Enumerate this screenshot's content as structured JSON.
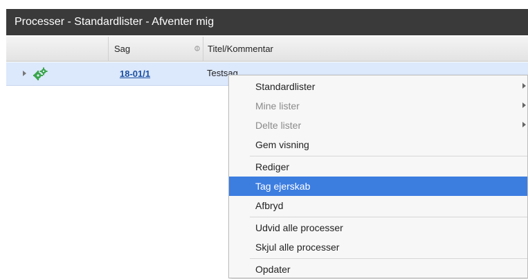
{
  "window": {
    "title": "Processer - Standardlister - Afventer mig"
  },
  "table": {
    "columns": {
      "sag": "Sag",
      "title": "Titel/Kommentar"
    },
    "rows": [
      {
        "case_number": "18-01/1",
        "title": "Testsag"
      }
    ]
  },
  "context_menu": {
    "items": [
      {
        "label": "Standardlister",
        "state": "enabled",
        "submenu": true
      },
      {
        "label": "Mine lister",
        "state": "disabled",
        "submenu": true
      },
      {
        "label": "Delte lister",
        "state": "disabled",
        "submenu": true
      },
      {
        "label": "Gem visning",
        "state": "enabled",
        "submenu": false
      },
      {
        "label": "Rediger",
        "state": "enabled",
        "submenu": false
      },
      {
        "label": "Tag ejerskab",
        "state": "highlighted",
        "submenu": false
      },
      {
        "label": "Afbryd",
        "state": "enabled",
        "submenu": false
      },
      {
        "label": "Udvid alle processer",
        "state": "enabled",
        "submenu": false
      },
      {
        "label": "Skjul alle processer",
        "state": "enabled",
        "submenu": false
      },
      {
        "label": "Opdater",
        "state": "enabled",
        "submenu": false
      }
    ]
  },
  "icons": {
    "process": "gears-icon",
    "sort": "sort-icon",
    "expand": "expand-arrow-icon"
  },
  "colors": {
    "titlebar": "#3a3a3a",
    "selected_row": "#dce8fb",
    "menu_highlight": "#3c7de0",
    "link": "#1a4fa0"
  }
}
